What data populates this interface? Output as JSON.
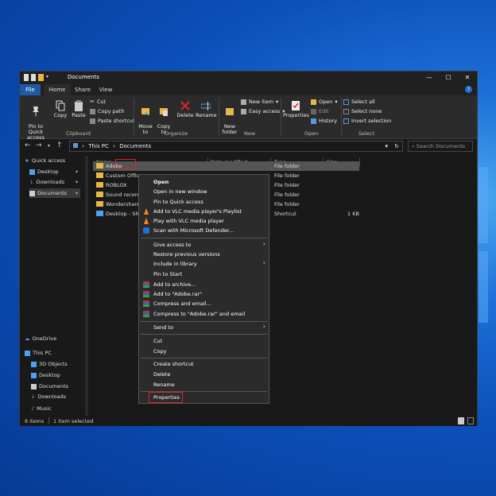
{
  "window": {
    "title": "Documents",
    "tabs": {
      "file": "File",
      "home": "Home",
      "share": "Share",
      "view": "View"
    }
  },
  "ribbon": {
    "pin": "Pin to Quick\naccess",
    "copy": "Copy",
    "paste": "Paste",
    "cut": "Cut",
    "copy_path": "Copy path",
    "paste_shortcut": "Paste shortcut",
    "move_to": "Move\nto",
    "copy_to": "Copy\nto",
    "delete": "Delete",
    "rename": "Rename",
    "new_folder": "New\nfolder",
    "new_item": "New item",
    "easy_access": "Easy access",
    "properties": "Properties",
    "open": "Open",
    "edit": "Edit",
    "history": "History",
    "select_all": "Select all",
    "select_none": "Select none",
    "invert_selection": "Invert selection",
    "groups": {
      "clipboard": "Clipboard",
      "organize": "Organize",
      "new": "New",
      "open": "Open",
      "select": "Select"
    }
  },
  "address": {
    "path_root": "This PC",
    "path_folder": "Documents",
    "search_placeholder": "Search Documents"
  },
  "nav_pane": {
    "quick_access": "Quick access",
    "items": [
      "Desktop",
      "Downloads",
      "Documents"
    ],
    "onedrive": "OneDrive",
    "this_pc": "This PC",
    "pc_items": [
      "3D Objects",
      "Desktop",
      "Documents",
      "Downloads",
      "Music"
    ]
  },
  "columns": {
    "name": "Name",
    "date": "Date modified",
    "type": "Type",
    "size": "Size"
  },
  "files": [
    {
      "name": "Adobe",
      "type": "File folder",
      "size": ""
    },
    {
      "name": "Custom Office",
      "type": "File folder",
      "size": ""
    },
    {
      "name": "ROBLOX",
      "type": "File folder",
      "size": ""
    },
    {
      "name": "Sound recordi",
      "type": "File folder",
      "size": ""
    },
    {
      "name": "Wondershare",
      "type": "File folder",
      "size": ""
    },
    {
      "name": "Desktop - Sho",
      "type": "Shortcut",
      "size": "1 KB"
    }
  ],
  "context_menu": {
    "open": "Open",
    "open_new_window": "Open in new window",
    "pin_quick": "Pin to Quick access",
    "vlc_playlist": "Add to VLC media player's Playlist",
    "vlc_play": "Play with VLC media player",
    "defender": "Scan with Microsoft Defender...",
    "give_access": "Give access to",
    "restore": "Restore previous versions",
    "include_library": "Include in library",
    "pin_start": "Pin to Start",
    "add_archive": "Add to archive...",
    "add_rar": "Add to \"Adobe.rar\"",
    "compress_email": "Compress and email...",
    "compress_rar_email": "Compress to \"Adobe.rar\" and email",
    "send_to": "Send to",
    "cut": "Cut",
    "copy": "Copy",
    "create_shortcut": "Create shortcut",
    "delete": "Delete",
    "rename": "Rename",
    "properties": "Properties"
  },
  "status": {
    "items": "6 items",
    "selected": "1 item selected"
  }
}
